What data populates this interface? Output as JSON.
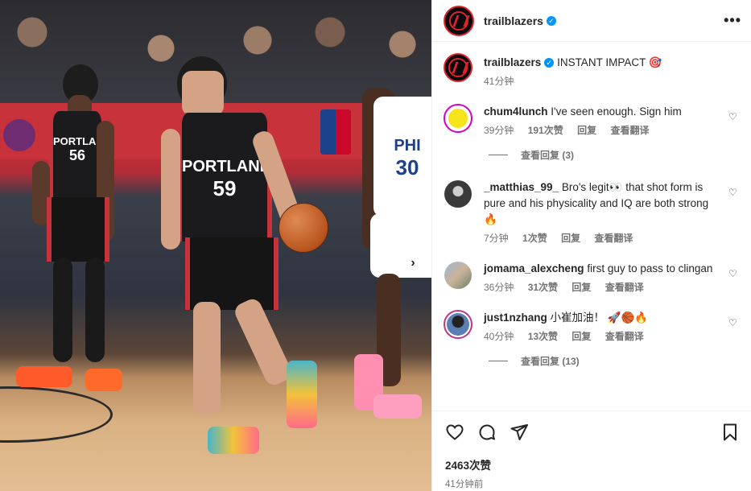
{
  "header": {
    "username": "trailblazers",
    "more_label": "•••"
  },
  "photo": {
    "jersey_main_team": "PORTLAND",
    "jersey_main_number": "59",
    "jersey_left_team": "PORTLAND",
    "jersey_left_number": "56",
    "jersey_right_team": "PHI",
    "jersey_right_number": "30",
    "next_label": "›"
  },
  "caption": {
    "username": "trailblazers",
    "text": "INSTANT IMPACT 🎯",
    "time": "41分钟"
  },
  "comments": [
    {
      "username": "chum4lunch",
      "text": "I've seen enough. Sign him",
      "time": "39分钟",
      "likes": "191次赞",
      "reply": "回复",
      "translate": "查看翻译",
      "view_replies": "查看回复 (3)"
    },
    {
      "username": "_matthias_99_",
      "text": "Bro's legit👀 that shot form is pure and his physicality and IQ are both strong 🔥",
      "time": "7分钟",
      "likes": "1次赞",
      "reply": "回复",
      "translate": "查看翻译",
      "view_replies": ""
    },
    {
      "username": "jomama_alexcheng",
      "text": "first guy to pass to clingan",
      "time": "36分钟",
      "likes": "31次赞",
      "reply": "回复",
      "translate": "查看翻译",
      "view_replies": ""
    },
    {
      "username": "just1nzhang",
      "text": "小崔加油！ 🚀🏀🔥",
      "time": "40分钟",
      "likes": "13次赞",
      "reply": "回复",
      "translate": "查看翻译",
      "view_replies": "查看回复 (13)"
    }
  ],
  "footer": {
    "likes": "2463次赞",
    "time": "41分钟前"
  },
  "colors": {
    "blazers_red": "#e0222f",
    "verified_blue": "#0095f6",
    "muted_text": "#737373"
  }
}
